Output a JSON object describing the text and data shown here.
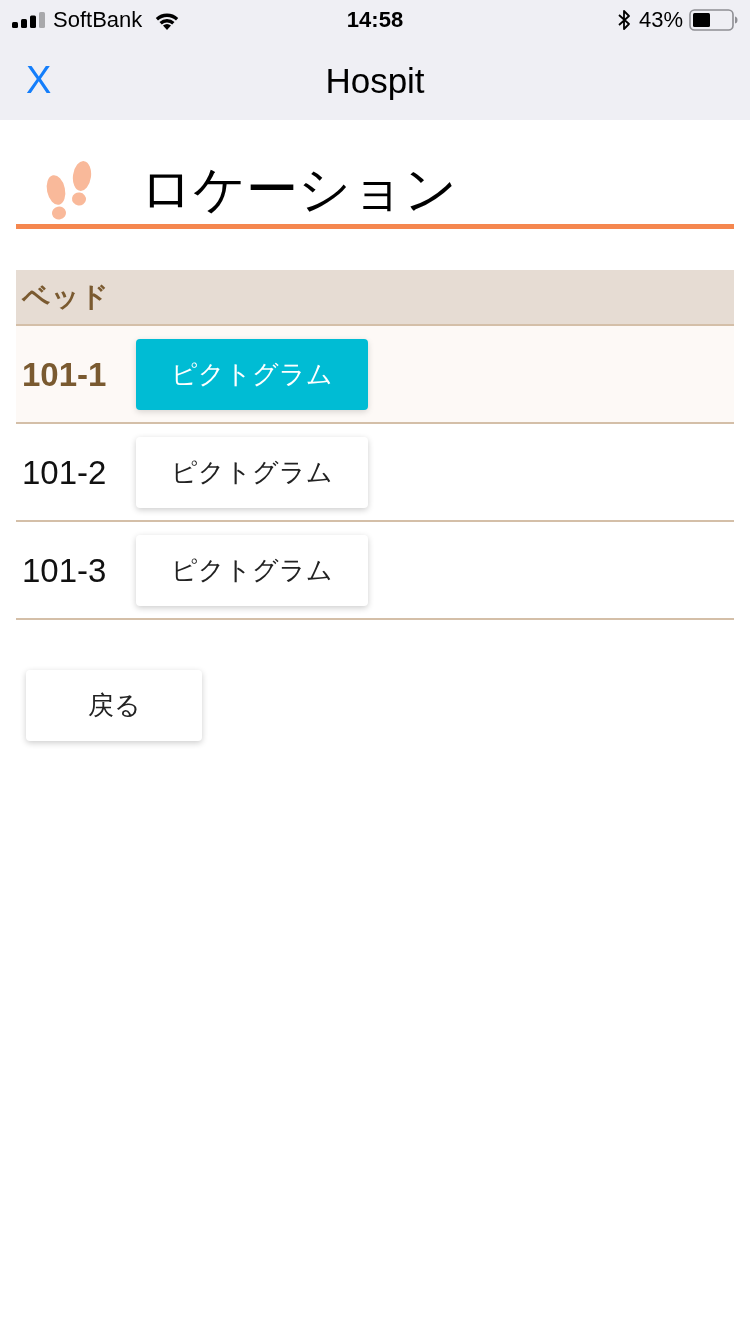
{
  "status_bar": {
    "carrier": "SoftBank",
    "time": "14:58",
    "battery": "43%"
  },
  "nav_bar": {
    "close": "X",
    "title": "Hospit"
  },
  "heading": {
    "title": "ロケーション"
  },
  "section": {
    "title": "ベッド",
    "rows": [
      {
        "label": "101-1",
        "button": "ピクトグラム",
        "selected": true
      },
      {
        "label": "101-2",
        "button": "ピクトグラム",
        "selected": false
      },
      {
        "label": "101-3",
        "button": "ピクトグラム",
        "selected": false
      }
    ]
  },
  "back_button": "戻る"
}
